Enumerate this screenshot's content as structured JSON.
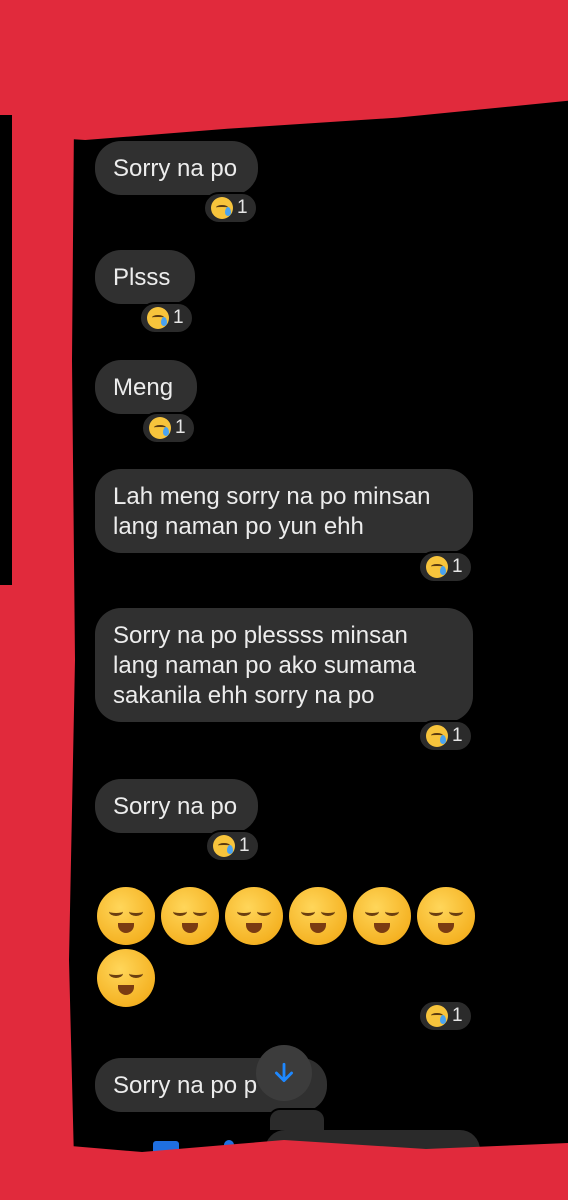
{
  "messages": [
    {
      "text": "Sorry na po",
      "reaction_count": "1"
    },
    {
      "text": "Plsss",
      "reaction_count": "1"
    },
    {
      "text": "Meng",
      "reaction_count": "1"
    },
    {
      "text": "Lah meng sorry na po minsan lang naman po yun ehh",
      "reaction_count": "1"
    },
    {
      "text": "Sorry na po plessss minsan lang naman po ako sumama sakanila ehh sorry na po",
      "reaction_count": "1"
    },
    {
      "text": "Sorry na po",
      "reaction_count": "1"
    },
    {
      "text": "😌😌😌😌😌😌😌",
      "reaction_count": "1"
    },
    {
      "text": "Sorry na po p"
    }
  ],
  "reaction_icon": "crying-face-icon",
  "big_emoji_icon": "relieved-face-icon",
  "scroll_button_icon": "arrow-down-icon",
  "colors": {
    "background": "#000000",
    "bubble": "#303030",
    "redaction": "#e12a3c",
    "accent": "#1e88ff"
  }
}
